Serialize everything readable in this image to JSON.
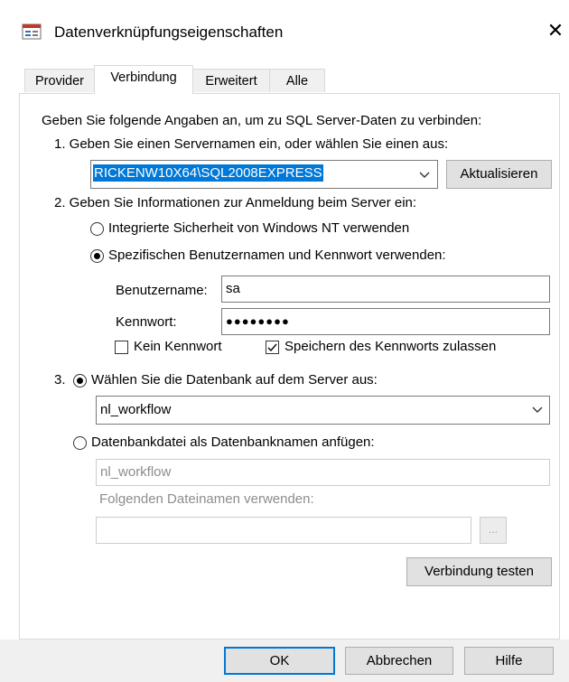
{
  "window": {
    "title": "Datenverknüpfungseigenschaften",
    "close_glyph": "✕",
    "app_icon": "data-link-icon"
  },
  "tabs": [
    {
      "label": "Provider",
      "active": false
    },
    {
      "label": "Verbindung",
      "active": true
    },
    {
      "label": "Erweitert",
      "active": false
    },
    {
      "label": "Alle",
      "active": false
    }
  ],
  "panel": {
    "intro": "Geben Sie folgende Angaben an, um zu SQL Server-Daten zu verbinden:",
    "step1": {
      "label": "1. Geben Sie einen Servernamen ein, oder wählen Sie einen aus:",
      "server_value": "RICKENW10X64\\SQL2008EXPRESS",
      "refresh_button": "Aktualisieren"
    },
    "step2": {
      "label": "2. Geben Sie Informationen zur Anmeldung beim Server ein:",
      "option_integrated": "Integrierte Sicherheit von Windows NT verwenden",
      "option_specific": "Spezifischen Benutzernamen und Kennwort verwenden:",
      "selected": "specific",
      "username_label": "Benutzername:",
      "username_value": "sa",
      "password_label": "Kennwort:",
      "password_value": "●●●●●●●●",
      "no_password_label": "Kein Kennwort",
      "no_password_checked": false,
      "save_password_label": "Speichern des Kennworts zulassen",
      "save_password_checked": true
    },
    "step3": {
      "number": "3.",
      "option_select_db": "Wählen Sie die Datenbank auf dem Server aus:",
      "database_value": "nl_workflow",
      "option_attach": "Datenbankdatei als Datenbanknamen anfügen:",
      "attach_db_value": "nl_workflow",
      "filename_label": "Folgenden Dateinamen verwenden:",
      "filename_value": "",
      "browse_button": "...",
      "selected": "select_db"
    },
    "test_button": "Verbindung testen"
  },
  "footer": {
    "ok": "OK",
    "cancel": "Abbrechen",
    "help": "Hilfe"
  },
  "colors": {
    "accent": "#0078d7",
    "selection_bg": "#0078d7",
    "disabled_text": "#8d8d8d"
  }
}
